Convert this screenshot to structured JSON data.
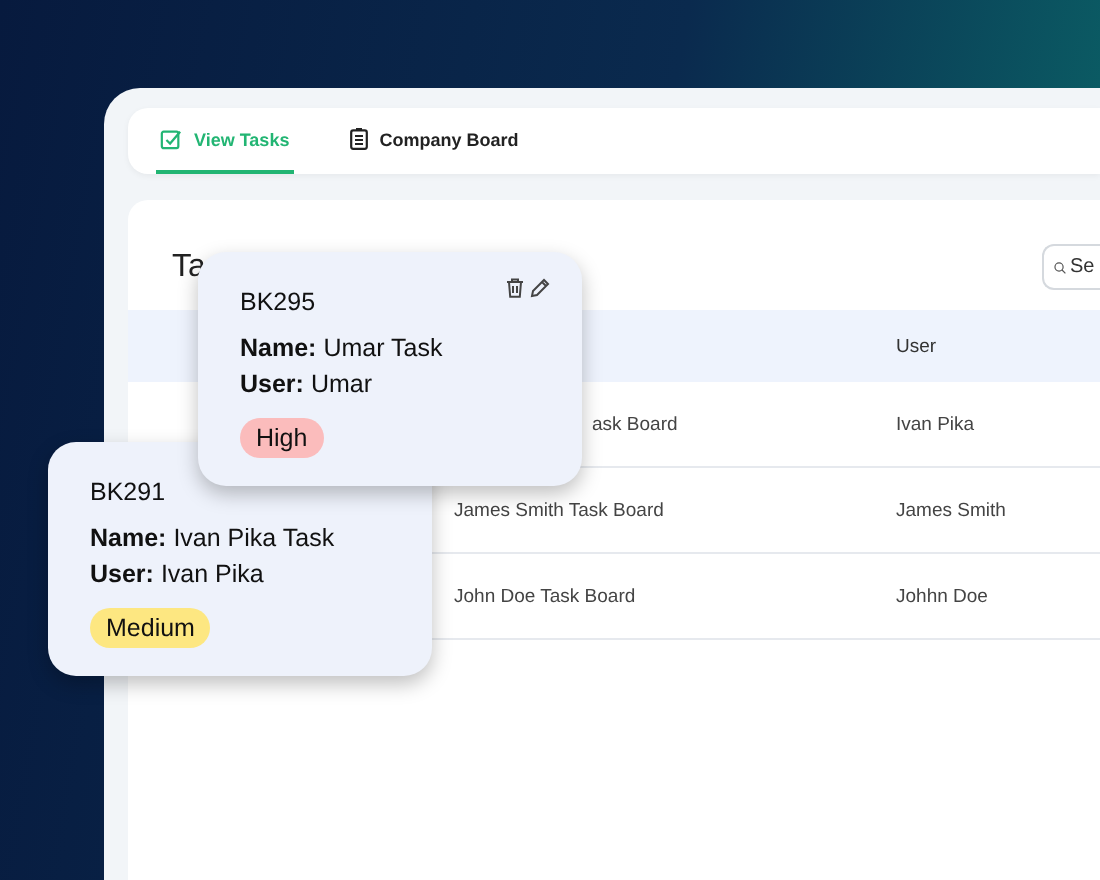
{
  "tabs": [
    {
      "label": "View Tasks",
      "selected": true,
      "kind": "check"
    },
    {
      "label": "Company Board",
      "selected": false,
      "kind": "clipboard"
    }
  ],
  "panel": {
    "title": "Ta",
    "search": {
      "placeholder": "Se"
    }
  },
  "table": {
    "columns": [
      "User"
    ],
    "rows": [
      {
        "column_2": "ask Board",
        "user": "Ivan Pika"
      },
      {
        "column_2": "James Smith Task Board",
        "user": "James Smith"
      },
      {
        "column_2": "John Doe Task Board",
        "user": "Johhn Doe"
      }
    ]
  },
  "cards": [
    {
      "id": "BK295",
      "name_label": "Name:",
      "name": "Umar Task",
      "user_label": "User:",
      "user": "Umar",
      "priority": "High",
      "color": "#fbbcbc",
      "actions": true
    },
    {
      "id": "BK291",
      "name_label": "Name:",
      "name": "Ivan Pika Task",
      "user_label": "User:",
      "user": "Ivan Pika",
      "priority": "Medium",
      "color": "#fde781",
      "actions": false
    }
  ]
}
